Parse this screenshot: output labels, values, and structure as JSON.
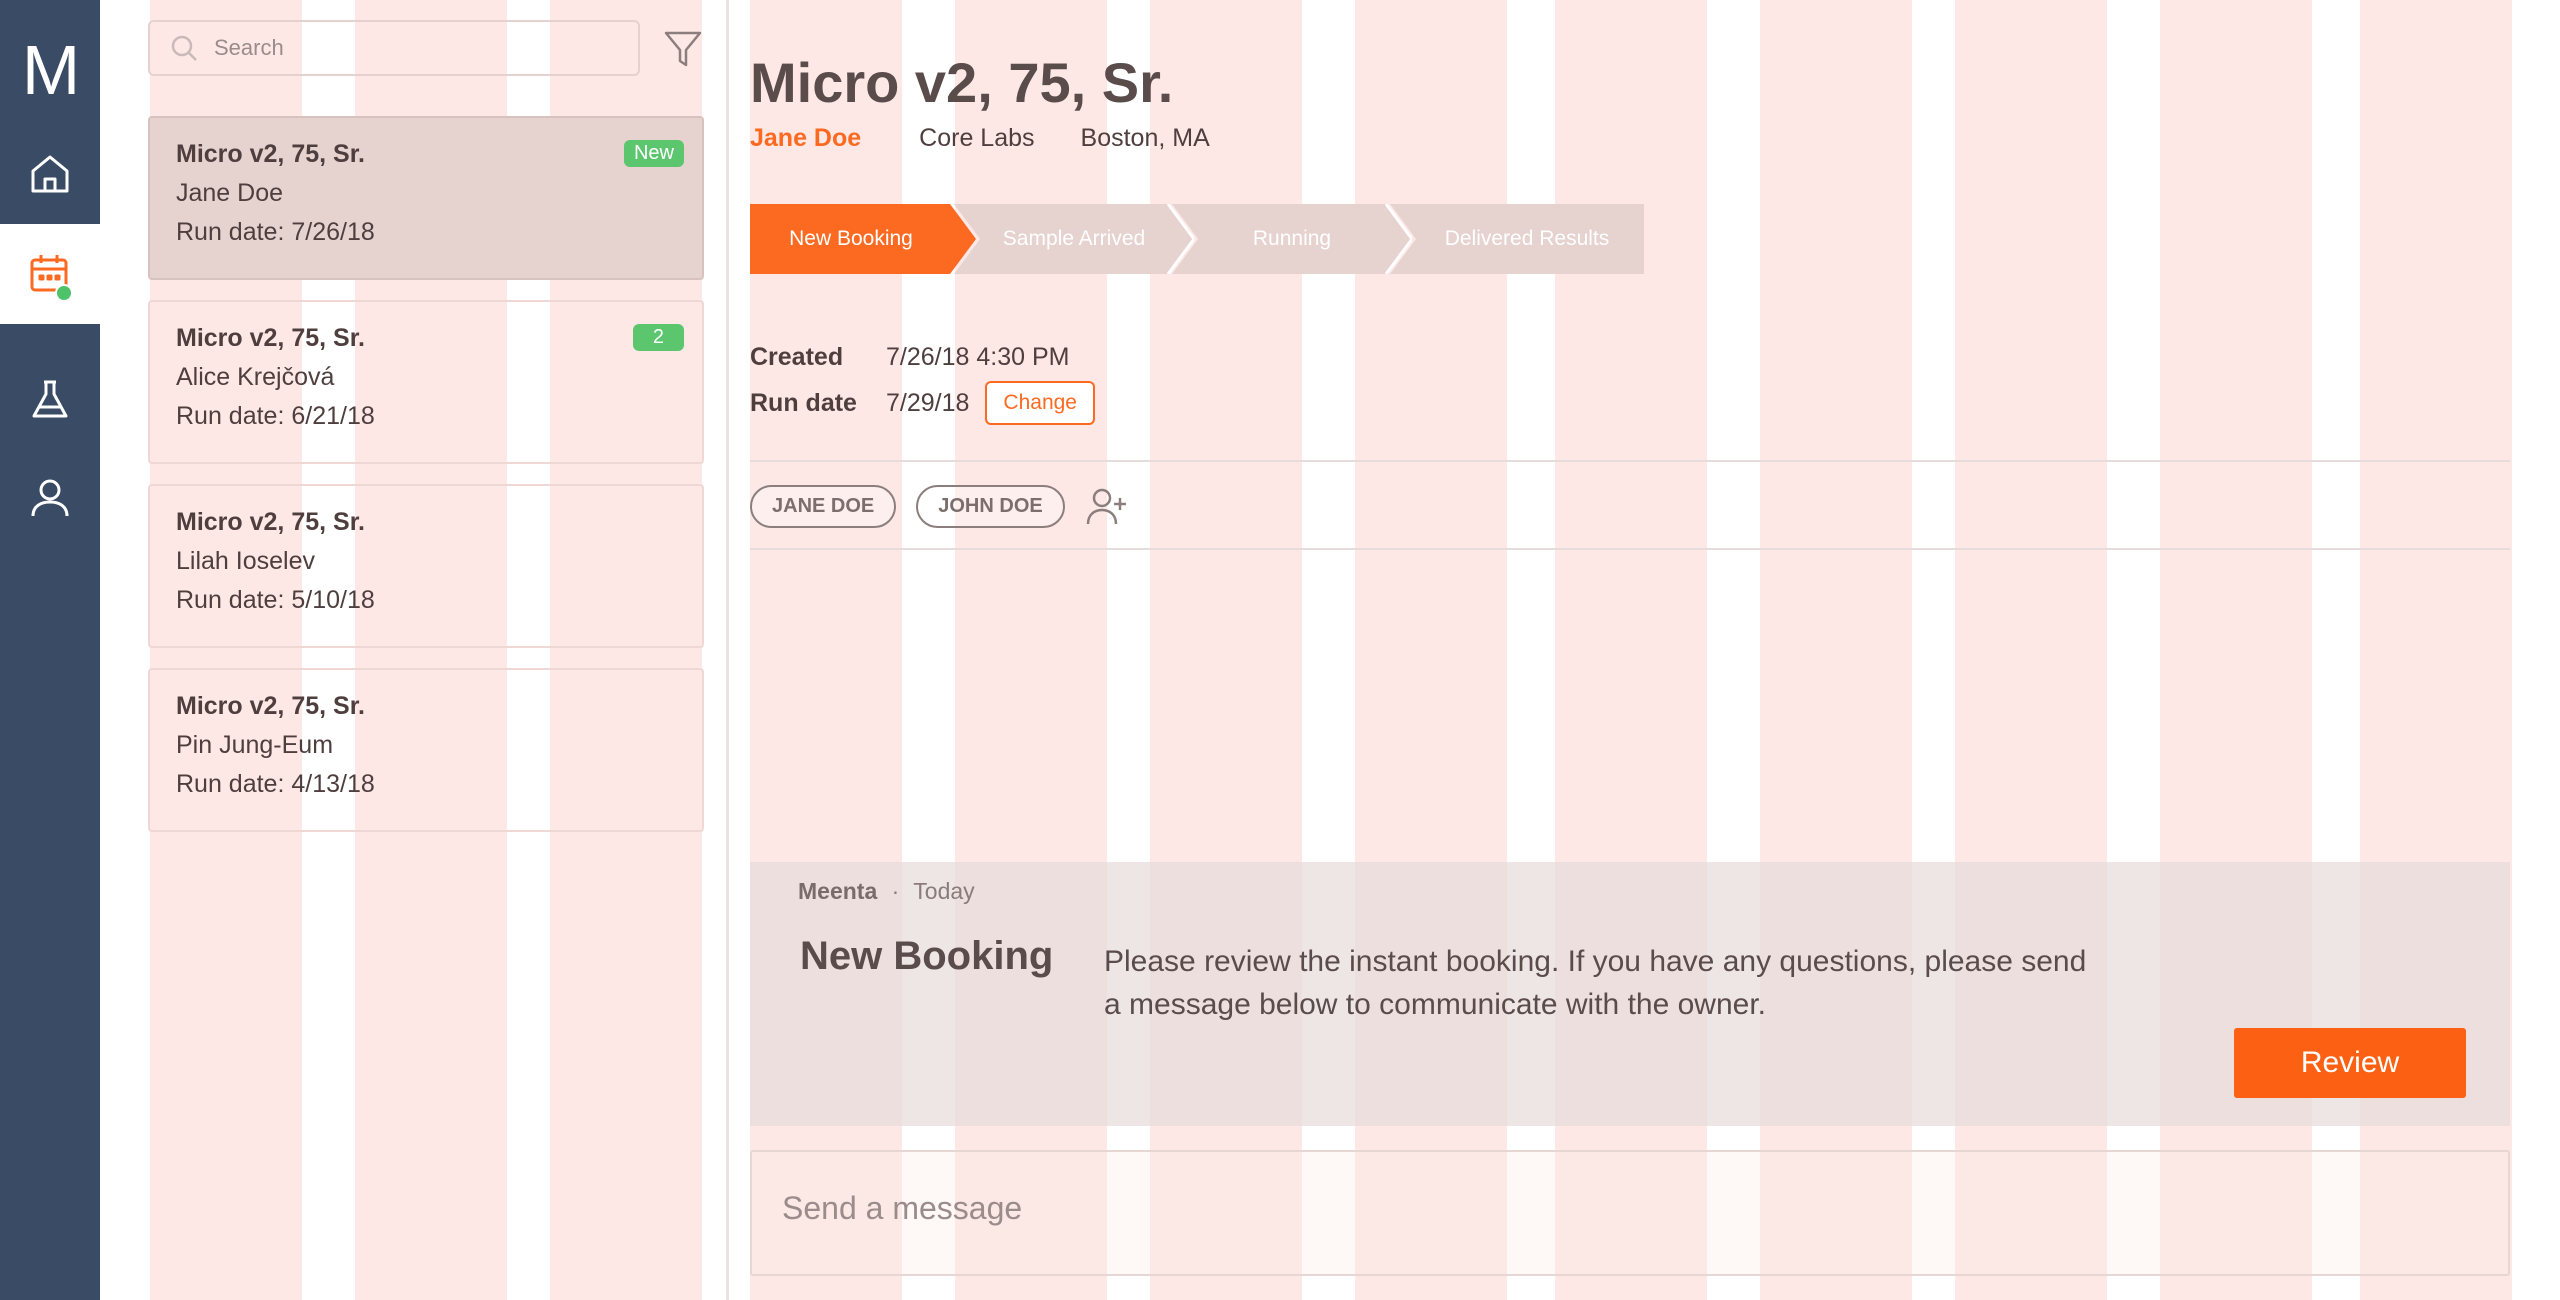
{
  "app": {
    "logo_text": "M",
    "accent": "#fc6a21",
    "sidebar_bg": "#3a4b65"
  },
  "sidebar": {
    "items": [
      {
        "name": "home",
        "icon": "home-icon"
      },
      {
        "name": "calendar",
        "icon": "calendar-icon",
        "active": true,
        "status_dot": "#4fc36a"
      },
      {
        "name": "lab",
        "icon": "flask-icon"
      },
      {
        "name": "profile",
        "icon": "user-icon"
      }
    ]
  },
  "search": {
    "placeholder": "Search"
  },
  "list": {
    "items": [
      {
        "title": "Micro v2, 75, Sr.",
        "name": "Jane Doe",
        "run_date": "Run date: 7/26/18",
        "badge": "New"
      },
      {
        "title": "Micro v2, 75, Sr.",
        "name": "Alice Krejčová",
        "run_date": "Run date: 6/21/18",
        "badge": "2"
      },
      {
        "title": "Micro v2, 75, Sr.",
        "name": "Lilah Ioselev",
        "run_date": "Run date: 5/10/18"
      },
      {
        "title": "Micro v2, 75, Sr.",
        "name": "Pin Jung-Eum",
        "run_date": "Run date: 4/13/18"
      }
    ]
  },
  "detail": {
    "title": "Micro v2, 75, Sr.",
    "owner": "Jane Doe",
    "lab": "Core Labs",
    "location": "Boston, MA",
    "steps": [
      "New Booking",
      "Sample Arrived",
      "Running",
      "Delivered Results"
    ],
    "created_label": "Created",
    "created_value": "7/26/18 4:30 PM",
    "run_date_label": "Run date",
    "run_date_value": "7/29/18",
    "change_label": "Change",
    "tags": [
      "JANE DOE",
      "JOHN DOE"
    ]
  },
  "message": {
    "author": "Meenta",
    "separator": "·",
    "time": "Today",
    "title": "New Booking",
    "body": "Please review the instant booking. If you have any questions, please send a message below to communicate with the owner.",
    "action": "Review"
  },
  "composer": {
    "placeholder": "Send a message"
  }
}
